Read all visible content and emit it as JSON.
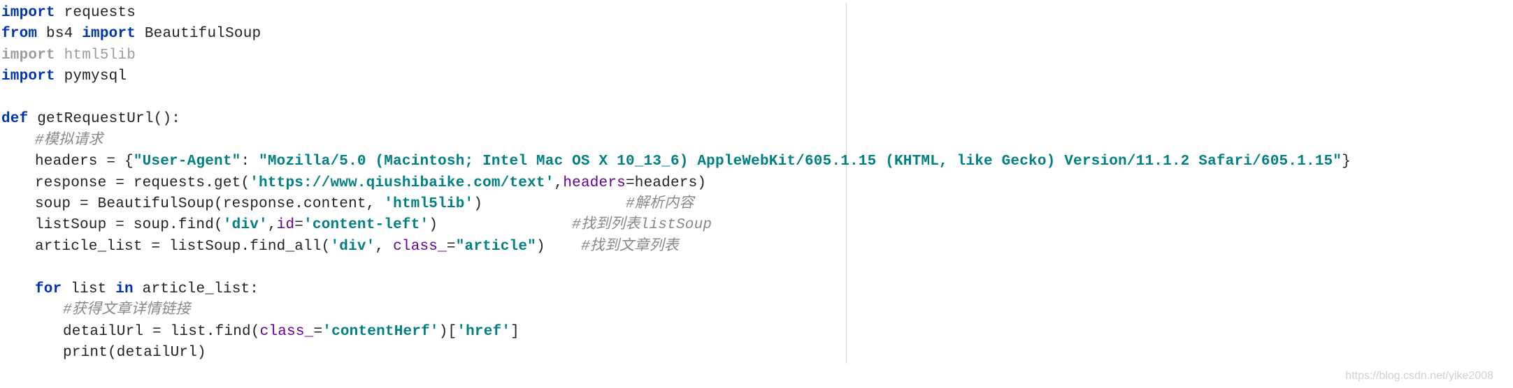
{
  "imports": {
    "l1_kw": "import",
    "l1_mod": "requests",
    "l2_kw1": "from",
    "l2_mod1": "bs4",
    "l2_kw2": "import",
    "l2_mod2": "BeautifulSoup",
    "l3_kw": "import",
    "l3_mod": "html5lib",
    "l4_kw": "import",
    "l4_mod": "pymysql"
  },
  "func": {
    "def_kw": "def",
    "name": "getRequestUrl",
    "parens": "():",
    "c1": "#模拟请求",
    "headers_lhs": "headers = {",
    "headers_key": "\"User-Agent\"",
    "headers_colon": ": ",
    "headers_val": "\"Mozilla/5.0 (Macintosh; Intel Mac OS X 10_13_6) AppleWebKit/605.1.15 (KHTML, like Gecko) Version/11.1.2 Safari/605.1.15\"",
    "headers_end": "}",
    "resp_lhs": "response = requests.get(",
    "resp_url": "'https://www.qiushibaike.com/text'",
    "resp_after_url": ",",
    "resp_param": "headers",
    "resp_eq": "=headers)",
    "soup_line_a": "soup = BeautifulSoup(response.content, ",
    "soup_str": "'html5lib'",
    "soup_line_b": ")",
    "soup_comment": "#解析内容",
    "listsoup_a": "listSoup = soup.find(",
    "listsoup_s1": "'div'",
    "listsoup_mid": ",",
    "listsoup_param": "id",
    "listsoup_eq": "=",
    "listsoup_s2": "'content-left'",
    "listsoup_close": ")",
    "listsoup_comment_a": "#找到列表",
    "listsoup_comment_b": "listSoup",
    "artlist_a": "article_list = listSoup.find_all(",
    "artlist_s1": "'div'",
    "artlist_mid": ", ",
    "artlist_param": "class_",
    "artlist_eq": "=",
    "artlist_s2": "\"article\"",
    "artlist_close": ")",
    "artlist_comment": "#找到文章列表",
    "for_kw1": "for",
    "for_var": "list",
    "for_kw2": "in",
    "for_iter": "article_list:",
    "for_comment": "#获得文章详情链接",
    "detail_a": "detailUrl = list.find(",
    "detail_param": "class_",
    "detail_eq": "=",
    "detail_s1": "'contentHerf'",
    "detail_b": ")[",
    "detail_s2": "'href'",
    "detail_c": "]",
    "print_a": "print(detailUrl)"
  },
  "watermark": "https://blog.csdn.net/yike2008"
}
